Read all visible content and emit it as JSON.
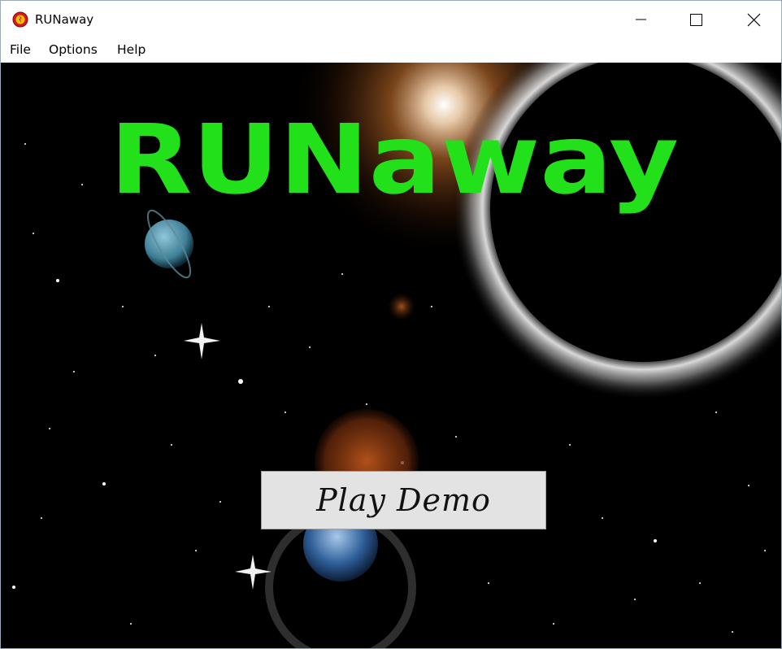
{
  "window": {
    "title": "RUNaway",
    "icon": "app-shield-icon",
    "controls": [
      "minimize-icon",
      "maximize-icon",
      "close-icon"
    ]
  },
  "menu": {
    "file": "File",
    "options": "Options",
    "help": "Help"
  },
  "game": {
    "logo": "RUNaway",
    "logo_color": "#22e01a",
    "play_button": "Play Demo",
    "background_color": "#000000"
  }
}
